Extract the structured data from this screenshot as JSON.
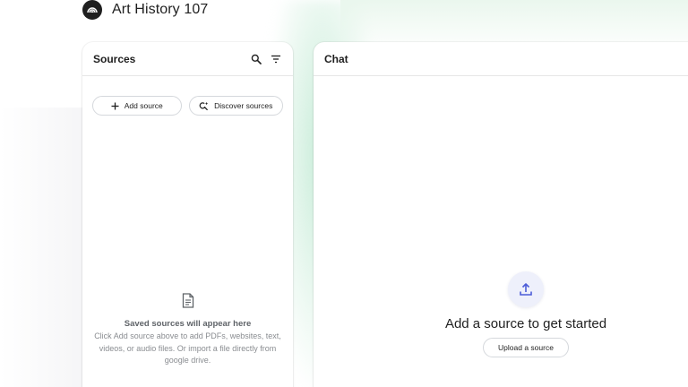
{
  "app": {
    "title": "Art History 107"
  },
  "sources": {
    "title": "Sources",
    "add_source_label": "Add source",
    "discover_sources_label": "Discover sources",
    "empty_title": "Saved sources will appear here",
    "empty_description": "Click Add source above to add PDFs, websites, text, videos, or audio files. Or import a file directly from google drive."
  },
  "chat": {
    "title": "Chat",
    "cta": "Add a source to get started",
    "upload_label": "Upload a source"
  },
  "icons": {
    "logo": "notebook-logo-icon",
    "search": "search-icon",
    "filter": "filter-icon",
    "add": "plus-icon",
    "discover": "discover-search-icon",
    "document": "document-icon",
    "upload": "upload-icon"
  },
  "colors": {
    "accent": "#4c5cd8",
    "text": "#1f1f1f",
    "muted": "#8a8d91",
    "border": "#d5d8dc"
  }
}
